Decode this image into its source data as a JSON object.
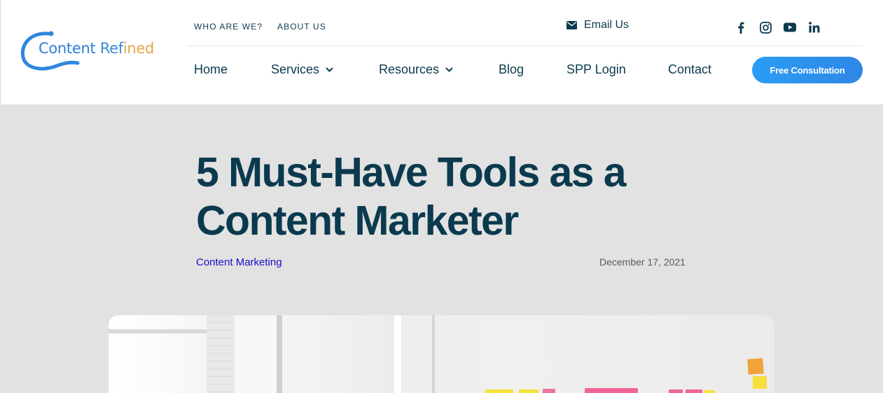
{
  "brand": {
    "name_part1": "Content",
    "name_part2": "Ref",
    "name_part3": "ined",
    "primary_color": "#2f7fd8",
    "accent_color": "#e7a64b"
  },
  "topbar": {
    "links": [
      "WHO ARE WE?",
      "ABOUT US"
    ],
    "email_label": "Email Us",
    "email_icon": "envelope-icon",
    "social_icons": [
      "facebook-icon",
      "instagram-icon",
      "youtube-icon",
      "linkedin-icon"
    ]
  },
  "nav": {
    "items": [
      {
        "label": "Home",
        "dropdown": false
      },
      {
        "label": "Services",
        "dropdown": true
      },
      {
        "label": "Resources",
        "dropdown": true
      },
      {
        "label": "Blog",
        "dropdown": false
      },
      {
        "label": "SPP Login",
        "dropdown": false
      },
      {
        "label": "Contact",
        "dropdown": false
      }
    ],
    "cta_label": "Free Consultation",
    "cta_color": "#2a9df4"
  },
  "article": {
    "title_line1": "5 Must-Have Tools as a",
    "title_line2": "Content Marketer",
    "category": "Content Marketing",
    "date": "December 17, 2021",
    "title_color": "#0b3a4e",
    "category_color": "#1a0dc6"
  },
  "feature_image": {
    "depicts": "photo-office-wall-sticky-notes"
  }
}
